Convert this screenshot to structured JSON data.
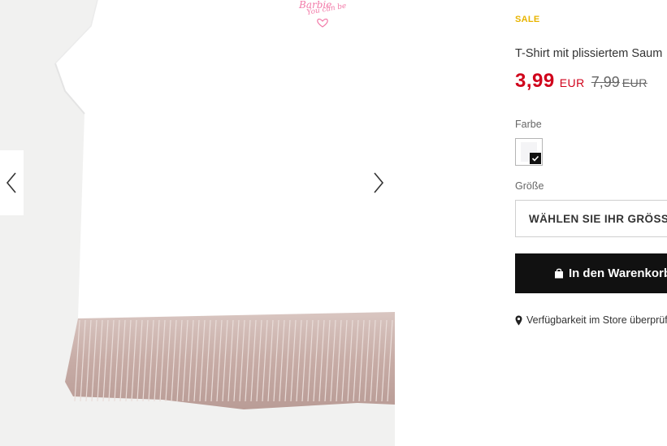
{
  "product": {
    "sale_badge": "SALE",
    "title": "T-Shirt mit plissiertem Saum",
    "price_now": "3,99",
    "currency_now": "EUR",
    "price_old": "7,99",
    "currency_old": "EUR"
  },
  "color": {
    "label": "Farbe",
    "selected": "weiß"
  },
  "size": {
    "label": "Größe",
    "select_placeholder": "WÄHLEN SIE IHR GRÖSSE"
  },
  "cart": {
    "button_label": "In den Warenkorb",
    "icon": "shopping-bag-icon"
  },
  "store": {
    "link_label": "Verfügbarkeit im Store überprüfen",
    "icon": "map-pin-icon"
  },
  "gallery": {
    "print_line1": "Barbie",
    "print_line2": "You can be",
    "prev_icon": "chevron-left-icon",
    "next_icon": "chevron-right-icon"
  },
  "colors": {
    "sale": "#e8b400",
    "price": "#d0021b",
    "button": "#111111"
  }
}
